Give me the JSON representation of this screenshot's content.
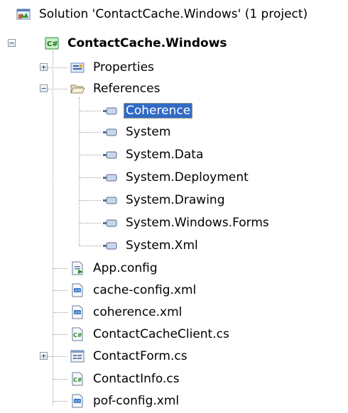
{
  "solution": {
    "label": "Solution 'ContactCache.Windows' (1 project)",
    "icon": "solution-icon"
  },
  "project": {
    "label": "ContactCache.Windows",
    "icon": "csharp-project-icon",
    "expanded": true
  },
  "items": [
    {
      "id": "properties",
      "label": "Properties",
      "icon": "properties-folder-icon",
      "expandable": true,
      "expanded": false
    },
    {
      "id": "references",
      "label": "References",
      "icon": "open-folder-icon",
      "expandable": true,
      "expanded": true
    },
    {
      "id": "cache-config",
      "label": "cache-config.xml",
      "icon": "xml-file-icon"
    }
  ],
  "references": [
    {
      "label": "Coherence",
      "selected": true
    },
    {
      "label": "System"
    },
    {
      "label": "System.Data"
    },
    {
      "label": "System.Deployment"
    },
    {
      "label": "System.Drawing"
    },
    {
      "label": "System.Windows.Forms"
    },
    {
      "label": "System.Xml"
    }
  ],
  "files": [
    {
      "label": "App.config",
      "icon": "config-file-icon"
    },
    {
      "label": "cache-config.xml",
      "icon": "xml-file-icon"
    },
    {
      "label": "coherence.xml",
      "icon": "xml-file-icon"
    },
    {
      "label": "ContactCacheClient.cs",
      "icon": "csharp-file-icon"
    },
    {
      "label": "ContactForm.cs",
      "icon": "form-file-icon",
      "expandable": true,
      "expanded": false
    },
    {
      "label": "ContactInfo.cs",
      "icon": "csharp-file-icon"
    },
    {
      "label": "pof-config.xml",
      "icon": "xml-file-icon"
    }
  ],
  "colors": {
    "selection": "#316ac5",
    "selection_text": "#ffffff"
  }
}
